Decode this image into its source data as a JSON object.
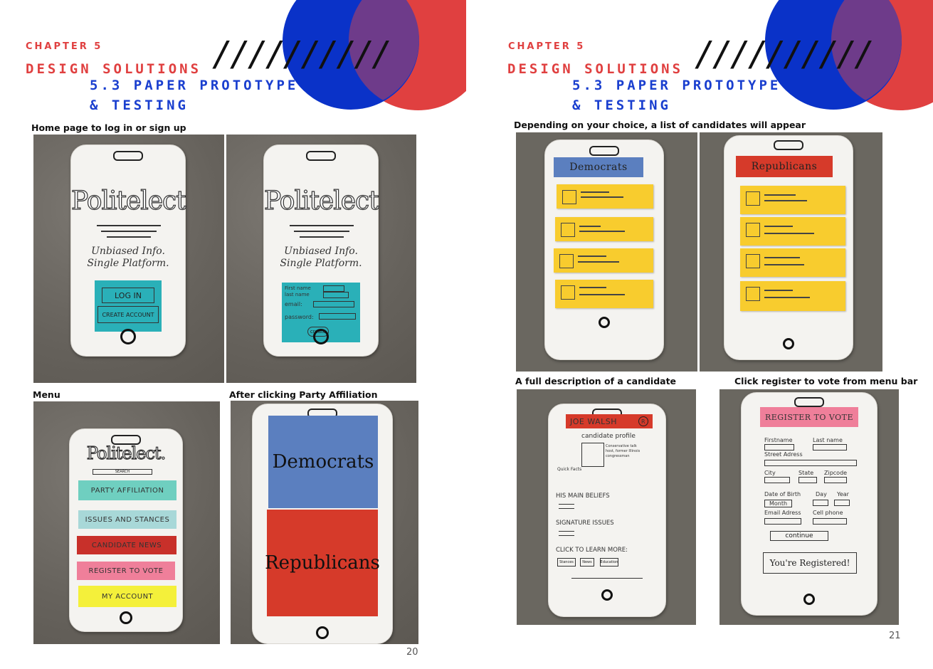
{
  "left_page": {
    "chapter": "CHAPTER 5",
    "title_line1": "DESIGN SOLUTIONS",
    "title_line2": "5.3 PAPER PROTOTYPE",
    "title_line3": "& TESTING",
    "slashes": "//////////",
    "captions": {
      "home": "Home page to log in or sign up",
      "menu": "Menu",
      "party": "After clicking Party Affiliation"
    },
    "page_number": "20",
    "sketch_text": {
      "logo": "Politelect",
      "tagline1": "Unbiased Info.",
      "tagline2": "Single Platform.",
      "login": "LOG IN",
      "create_account": "CREATE ACCOUNT",
      "firstname": "First name",
      "lastname": "last name",
      "email": "email:",
      "password": "password:",
      "create": "create",
      "menu_logo": "Politelect.",
      "search": "SEARCH",
      "menu_items": [
        "PARTY AFFILIATION",
        "ISSUES AND STANCES",
        "CANDIDATE NEWS",
        "REGISTER TO VOTE",
        "MY ACCOUNT"
      ],
      "democrats": "Democrats",
      "republicans": "Republicans"
    }
  },
  "right_page": {
    "chapter": "CHAPTER 5",
    "title_line1": "DESIGN SOLUTIONS",
    "title_line2": "5.3 PAPER PROTOTYPE",
    "title_line3": "& TESTING",
    "slashes": "//////////",
    "captions": {
      "list": "Depending on your choice, a list of candidates will appear",
      "description": "A full description of a candidate",
      "register": "Click register to vote from menu bar"
    },
    "page_number": "21",
    "sketch_text": {
      "democrats": "Democrats",
      "republicans": "Republicans",
      "candidate_name": "JOE WALSH",
      "party_badge": "R",
      "candidate_profile": "candidate profile",
      "bio": "Conservative talk host, former Illinois congressman",
      "quick_facts": "Quick Facts",
      "beliefs": "HIS MAIN BELIEFS",
      "signature": "SIGNATURE ISSUES",
      "learn_more": "CLICK TO LEARN MORE:",
      "learn_buttons": [
        "Stances",
        "News",
        "Education"
      ],
      "register_title": "REGISTER TO VOTE",
      "firstname": "Firstname",
      "lastname": "Last name",
      "street": "Street Adress",
      "city": "City",
      "state": "State",
      "zip": "Zipcode",
      "dob": "Date of Birth",
      "day": "Day",
      "year": "Year",
      "month": "Month",
      "email": "Email Adress",
      "cellphone": "Cell phone",
      "continue": "continue",
      "registered": "You're Registered!"
    }
  },
  "colors": {
    "red": "#e04040",
    "blue": "#1a3fcf",
    "purple": "#6e3b8a",
    "teal": "#2ab0b8",
    "yellow": "#f8cc2e",
    "dem_blue": "#5b7fbf",
    "rep_red": "#d63a2a"
  }
}
